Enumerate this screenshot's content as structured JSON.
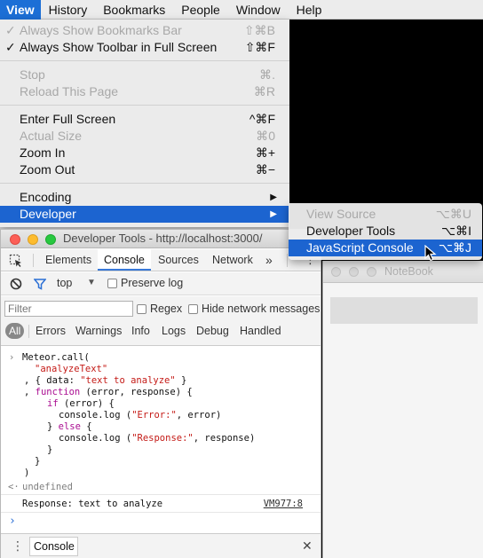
{
  "menubar": {
    "items": [
      "View",
      "History",
      "Bookmarks",
      "People",
      "Window",
      "Help"
    ]
  },
  "view_menu": {
    "always_show_bookmarks_bar": {
      "label": "Always Show Bookmarks Bar",
      "shortcut": "⇧⌘B",
      "checked": "✓"
    },
    "always_show_toolbar": {
      "label": "Always Show Toolbar in Full Screen",
      "shortcut": "⇧⌘F",
      "checked": "✓"
    },
    "stop": {
      "label": "Stop",
      "shortcut": "⌘."
    },
    "reload": {
      "label": "Reload This Page",
      "shortcut": "⌘R"
    },
    "enter_full_screen": {
      "label": "Enter Full Screen",
      "shortcut": "^⌘F"
    },
    "actual_size": {
      "label": "Actual Size",
      "shortcut": "⌘0"
    },
    "zoom_in": {
      "label": "Zoom In",
      "shortcut": "⌘+"
    },
    "zoom_out": {
      "label": "Zoom Out",
      "shortcut": "⌘−"
    },
    "encoding": {
      "label": "Encoding",
      "arrow": "▶"
    },
    "developer": {
      "label": "Developer",
      "arrow": "▶"
    }
  },
  "developer_submenu": {
    "view_source": {
      "label": "View Source",
      "shortcut": "⌥⌘U"
    },
    "developer_tools": {
      "label": "Developer Tools",
      "shortcut": "⌥⌘I"
    },
    "javascript_console": {
      "label": "JavaScript Console",
      "shortcut": "⌥⌘J"
    }
  },
  "devtools": {
    "title": "Developer Tools - http://localhost:3000/",
    "tabs": [
      "Elements",
      "Console",
      "Sources",
      "Network"
    ],
    "more_tabs": "»",
    "menu_dots": "⋮",
    "context": "top",
    "context_arrow": "▼",
    "preserve_log": "Preserve log",
    "filter_placeholder": "Filter",
    "regex": "Regex",
    "hide_network": "Hide network messages",
    "levels": [
      "All",
      "Errors",
      "Warnings",
      "Info",
      "Logs",
      "Debug",
      "Handled"
    ],
    "console_lines": {
      "prompt": "›",
      "l1": "Meteor.call(",
      "l2": "\"analyzeText\"",
      "l3a": ", { data: ",
      "l3b": "\"text to analyze\"",
      "l3c": " }",
      "l4a": ", ",
      "l4b": "function",
      "l4c": " (error, response) {",
      "l5a": "if",
      "l5b": " (error) {",
      "l6a": "console.log (",
      "l6b": "\"Error:\"",
      "l6c": ", error)",
      "l7a": "} ",
      "l7b": "else",
      "l7c": " {",
      "l8a": "console.log (",
      "l8b": "\"Response:\"",
      "l8c": ", response)",
      "l9": "}",
      "l10": "}",
      "l11": ")",
      "return_arrow": "<·",
      "undefined": "undefined",
      "log_output": "Response: text to analyze",
      "log_source": "VM977:8",
      "input_prompt": "›"
    },
    "drawer": {
      "tab": "Console",
      "close": "✕"
    }
  },
  "notebook": {
    "title": "NoteBook"
  },
  "colors": {
    "menu_highlight": "#1c64d0",
    "string": "#c41a16",
    "keyword": "#aa0d91",
    "tab_accent": "#3879d9"
  }
}
